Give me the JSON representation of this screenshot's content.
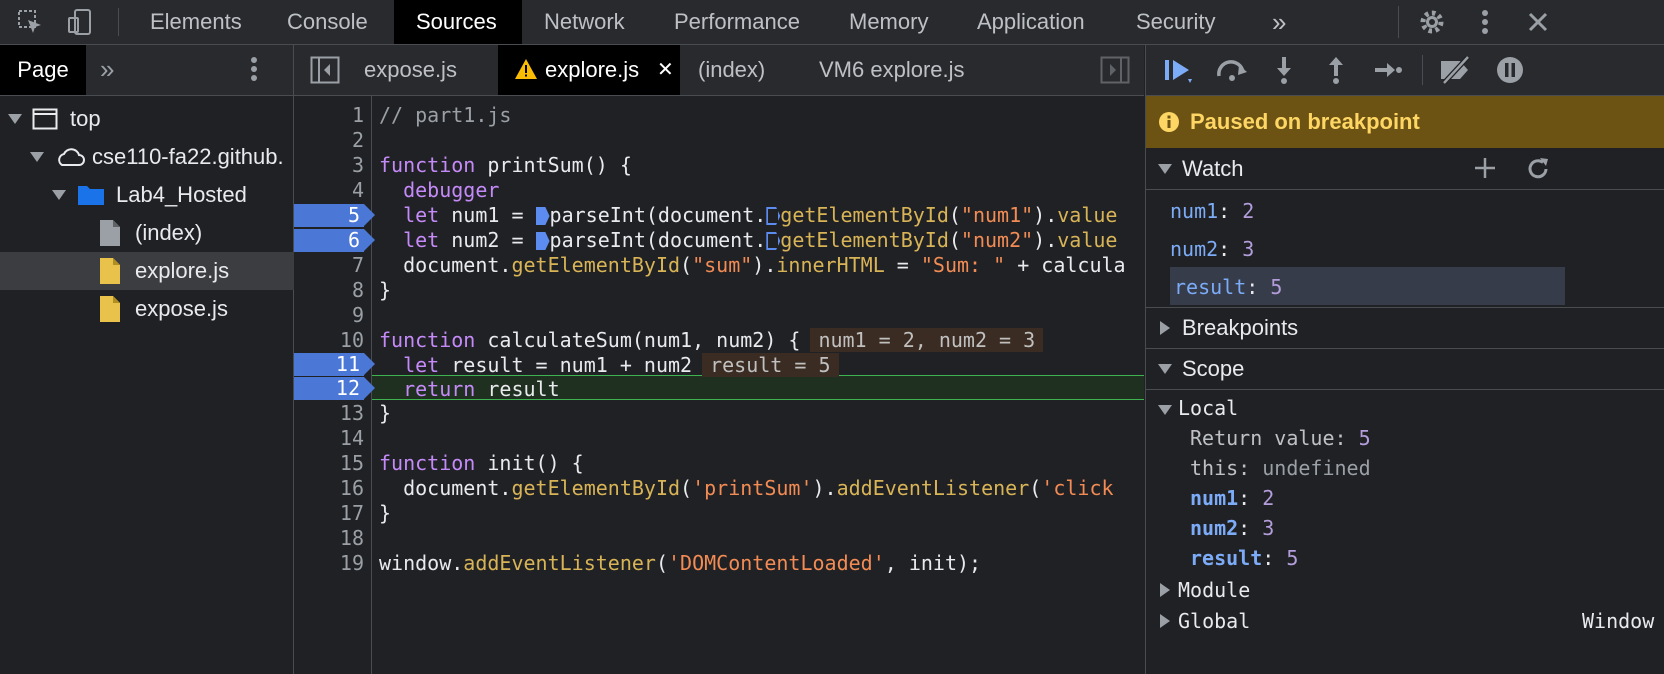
{
  "toolbar_icons": [
    "inspect-cursor-icon",
    "device-toggle-icon"
  ],
  "top_tabs": [
    "Elements",
    "Console",
    "Sources",
    "Network",
    "Performance",
    "Memory",
    "Application",
    "Security"
  ],
  "top_tabs_active": "Sources",
  "more_tabs_glyph": "»",
  "navigator": {
    "tab_label": "Page",
    "more_glyph": "»",
    "tree": [
      {
        "label": "top",
        "icon": "frame-icon"
      },
      {
        "label": "cse110-fa22.github.",
        "icon": "cloud-icon"
      },
      {
        "label": "Lab4_Hosted",
        "icon": "folder-icon"
      },
      {
        "label": "(index)",
        "icon": "file-icon"
      },
      {
        "label": "explore.js",
        "icon": "js-file-icon",
        "selected": true
      },
      {
        "label": "expose.js",
        "icon": "js-file-icon"
      }
    ]
  },
  "editor": {
    "tabs": [
      "expose.js",
      "explore.js",
      "(index)",
      "VM6 explore.js"
    ],
    "active_tab": "explore.js",
    "close_glyph": "✕",
    "breakpoint_lines": [
      5,
      6,
      11,
      12
    ],
    "current_line": 12,
    "line_numbers": [
      "1",
      "2",
      "3",
      "4",
      "5",
      "6",
      "7",
      "8",
      "9",
      "10",
      "11",
      "12",
      "13",
      "14",
      "15",
      "16",
      "17",
      "18",
      "19"
    ],
    "lines": [
      "// part1.js",
      "",
      "function printSum() {",
      "  debugger",
      "  let num1 = parseInt(document.getElementById(\"num1\").value",
      "  let num2 = parseInt(document.getElementById(\"num2\").value",
      "  document.getElementById(\"sum\").innerHTML = \"Sum: \" + calcula",
      "}",
      "",
      "function calculateSum(num1, num2) {",
      "  let result = num1 + num2",
      "  return result",
      "}",
      "",
      "function init() {",
      "  document.getElementById('printSum').addEventListener('click",
      "}",
      "",
      "window.addEventListener('DOMContentLoaded', init);"
    ],
    "inline_values": {
      "line10": "num1 = 2, num2 = 3",
      "line11": "result = 5"
    }
  },
  "debugger": {
    "paused_message": "Paused on breakpoint",
    "watch": {
      "title": "Watch",
      "items": [
        {
          "name": "num1",
          "value": "2"
        },
        {
          "name": "num2",
          "value": "3"
        },
        {
          "name": "result",
          "value": "5"
        }
      ]
    },
    "breakpoints_title": "Breakpoints",
    "scope": {
      "title": "Scope",
      "local_title": "Local",
      "items": [
        {
          "name": "Return value",
          "value": "5"
        },
        {
          "name": "this",
          "value": "undefined"
        },
        {
          "name": "num1",
          "value": "2"
        },
        {
          "name": "num2",
          "value": "3"
        },
        {
          "name": "result",
          "value": "5"
        }
      ],
      "module_title": "Module",
      "global_title": "Global",
      "global_value": "Window"
    }
  },
  "colors": {
    "accent": "#4b78d6",
    "paused_bg": "#6c5314",
    "paused_text": "#fdd663",
    "current_line_border": "#3fb34f"
  }
}
